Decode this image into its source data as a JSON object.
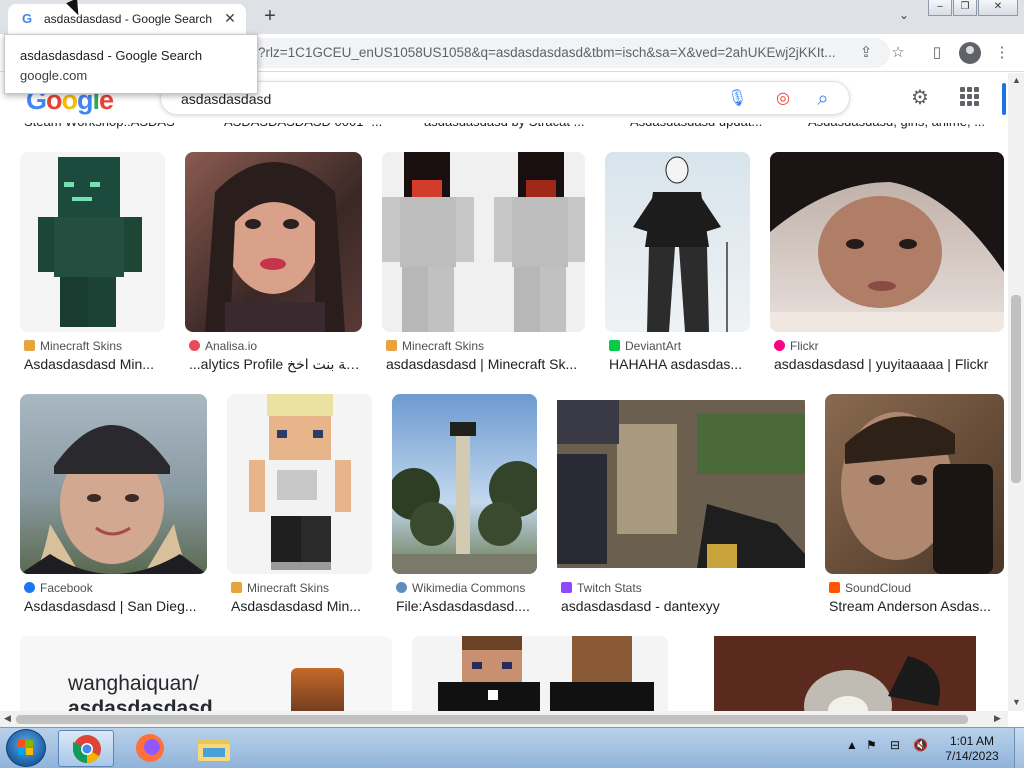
{
  "browser": {
    "tab_title": "asdasdasdasd - Google Search",
    "tab_favicon": "G",
    "url": "?rlz=1C1GCEU_enUS1058US1058&q=asdasdasdasd&tbm=isch&sa=X&ved=2ahUKEwj2jKKIt...",
    "tooltip_title": "asdasdasdasd - Google Search",
    "tooltip_domain": "google.com"
  },
  "google": {
    "logo_letters": [
      "G",
      "o",
      "o",
      "g",
      "l",
      "e"
    ],
    "logo_colors": [
      "#4285f4",
      "#ea4335",
      "#fbbc05",
      "#4285f4",
      "#34a853",
      "#ea4335"
    ],
    "query": "asdasdasdasd"
  },
  "previous_row": [
    "Steam Workshop::ASDAS...",
    "ASDASDASDASD 0001 -...",
    "asdasdasdasd by Stracat ...",
    "Asdasdasdasd updat...",
    "Asdasdasdasd, girls, anime, ..."
  ],
  "results": [
    {
      "source": "Minecraft Skins",
      "caption": "Asdasdasdasd Min...",
      "source_color": "#e8a33d"
    },
    {
      "source": "Analisa.io",
      "caption": "...alytics Profile كحبة بنت اخخ",
      "source_color": "#e94b5b"
    },
    {
      "source": "Minecraft Skins",
      "caption": "asdasdasdasd | Minecraft Sk...",
      "source_color": "#e8a33d"
    },
    {
      "source": "DeviantArt",
      "caption": "HAHAHA asdasdas...",
      "source_color": "#05cc47"
    },
    {
      "source": "Flickr",
      "caption": "asdasdasdasd | yuyitaaaaa | Flickr",
      "source_color": "#ff0084"
    },
    {
      "source": "Facebook",
      "caption": "Asdasdasdasd | San Dieg...",
      "source_color": "#1877f2"
    },
    {
      "source": "Minecraft Skins",
      "caption": "Asdasdasdasd Min...",
      "source_color": "#e8a33d"
    },
    {
      "source": "Wikimedia Commons",
      "caption": "File:Asdasdasdasd....",
      "source_color": "#5c8fbf"
    },
    {
      "source": "Twitch Stats",
      "caption": "asdasdasdasd - dantexyy",
      "source_color": "#9146ff"
    },
    {
      "source": "SoundCloud",
      "caption": "Stream Anderson Asdas...",
      "source_color": "#ff5500"
    }
  ],
  "third_row": {
    "line1": "wanghaiquan/",
    "line2": "asdasdasdasd"
  },
  "taskbar": {
    "time": "1:01 AM",
    "date": "7/14/2023"
  },
  "icons": {
    "close": "✕",
    "new_tab": "+",
    "tab_search": "⌄",
    "share": "⇪",
    "star": "☆",
    "side_panel": "▯",
    "menu": "⋮",
    "mic": "🎙",
    "lens": "◎",
    "search": "⌕",
    "gear": "⚙"
  }
}
